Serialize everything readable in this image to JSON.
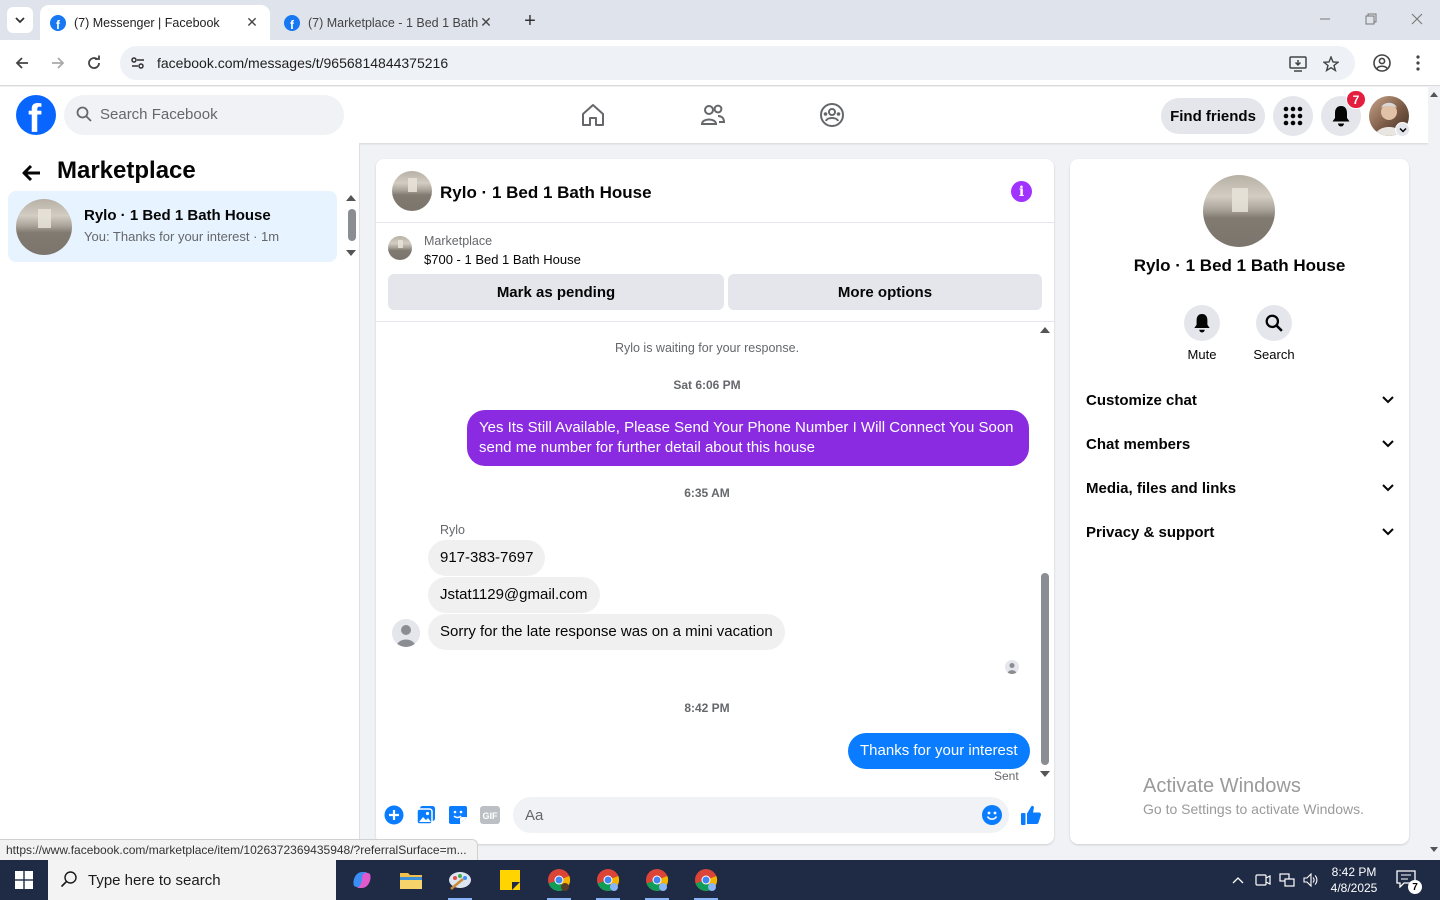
{
  "browser": {
    "tabs": [
      {
        "title": "(7) Messenger | Facebook",
        "active": true
      },
      {
        "title": "(7) Marketplace - 1 Bed 1 Bath House",
        "active": false
      }
    ],
    "url": "facebook.com/messages/t/9656814844375216",
    "status_url": "https://www.facebook.com/marketplace/item/1026372369435948/?referralSurface=m..."
  },
  "header": {
    "search_placeholder": "Search Facebook",
    "find_friends": "Find friends",
    "notification_count": "7"
  },
  "left": {
    "title": "Marketplace",
    "chats": [
      {
        "name": "Rylo · 1 Bed 1 Bath House",
        "snippet": "You: Thanks for your interest · 1m"
      }
    ]
  },
  "conversation": {
    "title": "Rylo · 1 Bed 1 Bath House",
    "listing_source": "Marketplace",
    "listing_title": "$700 - 1 Bed 1 Bath House",
    "actions": {
      "pending": "Mark as pending",
      "more": "More options"
    },
    "system_note": "Rylo is waiting for your response.",
    "time_1": "Sat 6:06 PM",
    "outgoing_1_line1": "Yes Its Still Available, Please Send Your Phone Number I Will Connect You Soon",
    "outgoing_1_line2": "send me number for further detail about this house",
    "time_2": "6:35 AM",
    "sender": "Rylo",
    "incoming": [
      "917-383-7697",
      "Jstat1129@gmail.com",
      "Sorry for the late response was on a mini vacation"
    ],
    "time_3": "8:42 PM",
    "outgoing_2": "Thanks for your interest",
    "sent_label": "Sent",
    "composer_placeholder": "Aa",
    "accent_color": "#8a2be2",
    "sent_color": "#0a7cff"
  },
  "details": {
    "name": "Rylo · 1 Bed 1 Bath House",
    "mute": "Mute",
    "search": "Search",
    "sections": [
      "Customize chat",
      "Chat members",
      "Media, files and links",
      "Privacy & support"
    ]
  },
  "watermark": {
    "line1": "Activate Windows",
    "line2": "Go to Settings to activate Windows."
  },
  "taskbar": {
    "search_placeholder": "Type here to search",
    "time": "8:42 PM",
    "date": "4/8/2025",
    "notification_count": "7"
  }
}
